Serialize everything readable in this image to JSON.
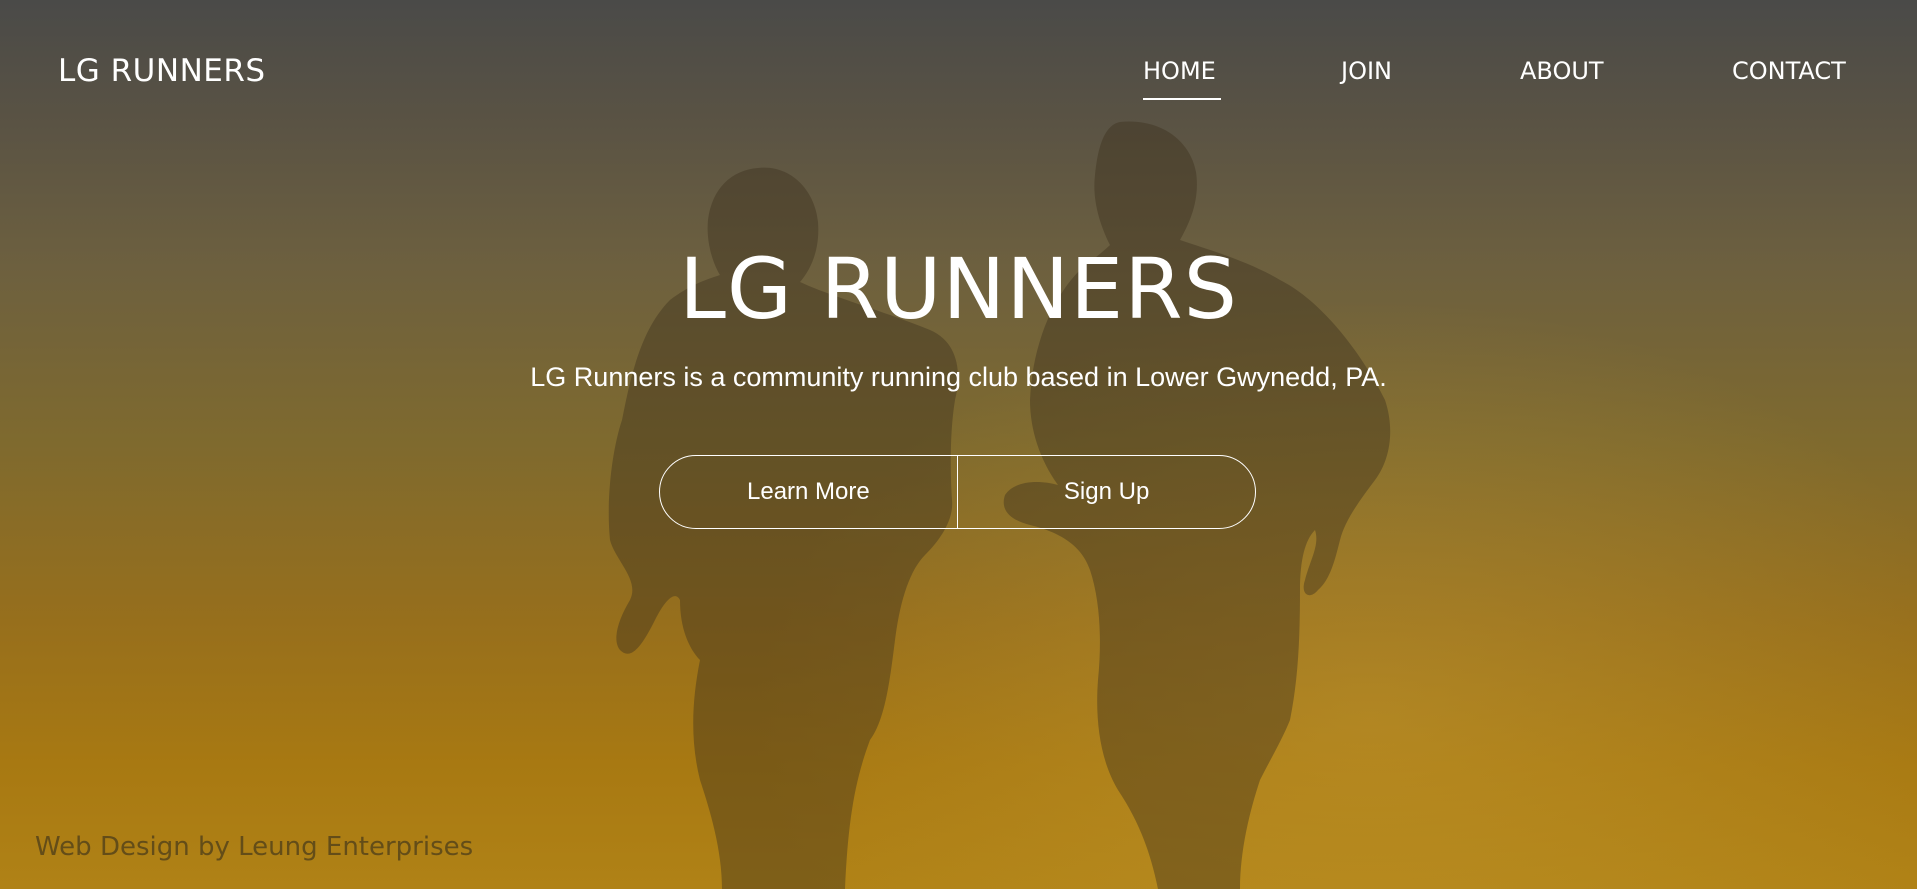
{
  "header": {
    "logo": "LG RUNNERS",
    "nav": [
      {
        "label": "HOME",
        "active": true
      },
      {
        "label": "JOIN",
        "active": false
      },
      {
        "label": "ABOUT",
        "active": false
      },
      {
        "label": "CONTACT",
        "active": false
      }
    ]
  },
  "hero": {
    "title": "LG RUNNERS",
    "subtitle": "LG Runners is a community running club based in Lower Gwynedd, PA.",
    "buttons": {
      "learn_more": "Learn More",
      "sign_up": "Sign Up"
    }
  },
  "footer": {
    "credit": "Web Design by Leung Enterprises"
  },
  "colors": {
    "text": "#ffffff",
    "gradient_top": "#4a4a48",
    "gradient_bottom": "#b08216"
  }
}
